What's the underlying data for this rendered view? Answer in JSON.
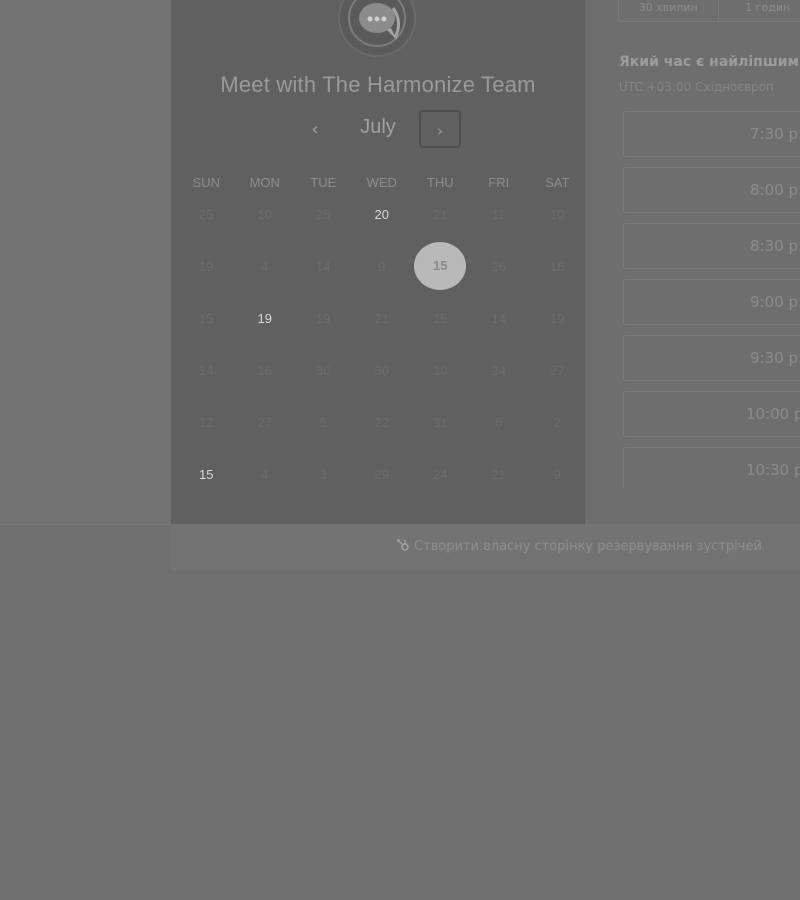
{
  "calendar": {
    "title": "Meet with The Harmonize Team",
    "month": "July",
    "prev_label": "‹",
    "next_label": "›",
    "weekdays": [
      "SUN",
      "MON",
      "TUE",
      "WED",
      "THU",
      "FRI",
      "SAT"
    ],
    "weeks": [
      [
        "25",
        "10",
        "25",
        "20",
        "21",
        "11",
        "10"
      ],
      [
        "19",
        "4",
        "14",
        "9",
        "15",
        "26",
        "18"
      ],
      [
        "15",
        "19",
        "19",
        "21",
        "15",
        "14",
        "19"
      ],
      [
        "14",
        "16",
        "30",
        "30",
        "10",
        "24",
        "27"
      ],
      [
        "12",
        "27",
        "5",
        "22",
        "31",
        "6",
        "2"
      ],
      [
        "15",
        "4",
        "3",
        "29",
        "24",
        "21",
        "9"
      ]
    ],
    "available_days": [
      "20",
      "19",
      "15"
    ],
    "selected_day": "15"
  },
  "booking": {
    "durations": [
      "30 хвилин",
      "1 годин"
    ],
    "question": "Який час є найліпшим",
    "timezone": "UTC +03:00 Східноєвроп",
    "slots": [
      "7:30 p",
      "8:00 p",
      "8:30 p",
      "9:00 p",
      "9:30 p",
      "10:00 p",
      "10:30 p"
    ]
  },
  "footer": {
    "link_text": "Створити власну сторінку резервування зустрічей"
  },
  "colors": {
    "overlay": "#6f6f6f",
    "calendar_panel": "#606060",
    "selected_day": "#b9b9b9"
  }
}
